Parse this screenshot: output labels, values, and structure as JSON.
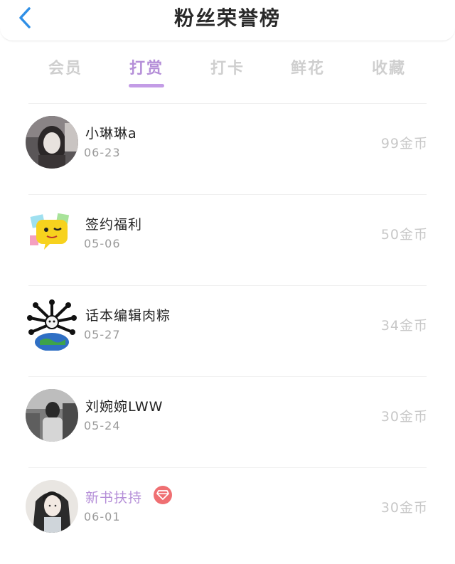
{
  "header": {
    "title": "粉丝荣誉榜"
  },
  "tabs": [
    {
      "label": "会员",
      "active": false
    },
    {
      "label": "打赏",
      "active": true
    },
    {
      "label": "打卡",
      "active": false
    },
    {
      "label": "鲜花",
      "active": false
    },
    {
      "label": "收藏",
      "active": false
    }
  ],
  "colors": {
    "accent": "#c39ce6",
    "tab_inactive": "#cfcfcf",
    "vip_name": "#b58fd8",
    "badge": "#ef6f72"
  },
  "list": [
    {
      "name": "小琳琳a",
      "date": "06-23",
      "amount": "99金币",
      "avatar": "avatar-photo-girl",
      "vip": false
    },
    {
      "name": "签约福利",
      "date": "05-06",
      "amount": "50金币",
      "avatar": "avatar-emoji-wink",
      "vip": false
    },
    {
      "name": "话本编辑肉粽",
      "date": "05-27",
      "amount": "34金币",
      "avatar": "avatar-cartoon-globe",
      "vip": false
    },
    {
      "name": "刘婉婉LWW",
      "date": "05-24",
      "amount": "30金币",
      "avatar": "avatar-photo-bw",
      "vip": false
    },
    {
      "name": "新书扶持",
      "date": "06-01",
      "amount": "30金币",
      "avatar": "avatar-illustration",
      "vip": true,
      "badge": "diamond-badge-icon"
    }
  ]
}
